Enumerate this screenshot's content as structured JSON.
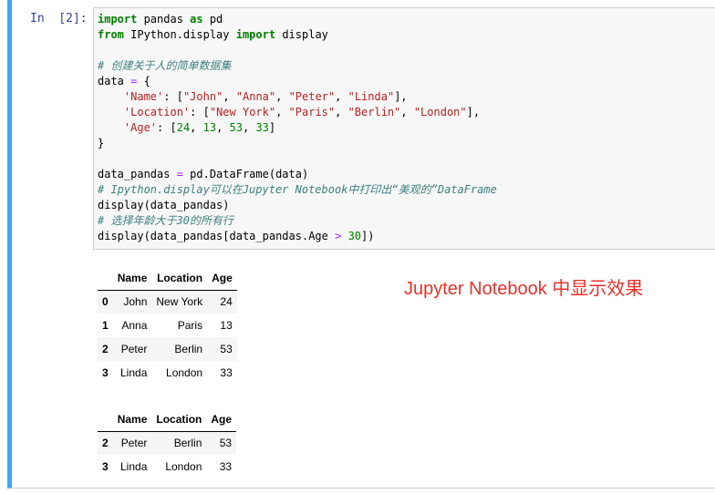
{
  "prompt": "In  [2]:",
  "code": {
    "line1": {
      "k1": "import",
      "t1": " pandas ",
      "k2": "as",
      "t2": " pd"
    },
    "line2": {
      "k1": "from",
      "t1": " IPython.display ",
      "k2": "import",
      "t2": " display"
    },
    "comment1": "# 创建关于人的简单数据集",
    "line4": {
      "t1": "data ",
      "op": "=",
      "t2": " {"
    },
    "line5": {
      "pre": "    ",
      "s1": "'Name'",
      "mid": ": [",
      "v1": "\"John\"",
      "c1": ", ",
      "v2": "\"Anna\"",
      "c2": ", ",
      "v3": "\"Peter\"",
      "c3": ", ",
      "v4": "\"Linda\"",
      "end": "],"
    },
    "line6": {
      "pre": "    ",
      "s1": "'Location'",
      "mid": ": [",
      "v1": "\"New York\"",
      "c1": ", ",
      "v2": "\"Paris\"",
      "c2": ", ",
      "v3": "\"Berlin\"",
      "c3": ", ",
      "v4": "\"London\"",
      "end": "],"
    },
    "line7": {
      "pre": "    ",
      "s1": "'Age'",
      "mid": ": [",
      "v1": "24",
      "c1": ", ",
      "v2": "13",
      "c2": ", ",
      "v3": "53",
      "c3": ", ",
      "v4": "33",
      "end": "]"
    },
    "line8": "}",
    "line10": {
      "t1": "data_pandas ",
      "op": "=",
      "t2": " pd.DataFrame(data)"
    },
    "comment2": "# Ipython.display可以在Jupyter Notebook中打印出“美观的”DataFrame",
    "line12": "display(data_pandas)",
    "comment3": "# 选择年龄大于30的所有行",
    "line14": {
      "t1": "display(data_pandas[data_pandas.Age ",
      "op": ">",
      "t2": " ",
      "n": "30",
      "t3": "])"
    }
  },
  "table1": {
    "headers": [
      "",
      "Name",
      "Location",
      "Age"
    ],
    "rows": [
      [
        "0",
        "John",
        "New York",
        "24"
      ],
      [
        "1",
        "Anna",
        "Paris",
        "13"
      ],
      [
        "2",
        "Peter",
        "Berlin",
        "53"
      ],
      [
        "3",
        "Linda",
        "London",
        "33"
      ]
    ]
  },
  "table2": {
    "headers": [
      "",
      "Name",
      "Location",
      "Age"
    ],
    "rows": [
      [
        "2",
        "Peter",
        "Berlin",
        "53"
      ],
      [
        "3",
        "Linda",
        "London",
        "33"
      ]
    ]
  },
  "annotation": "Jupyter Notebook 中显示效果",
  "colors": {
    "cell_border": "#42a5f5",
    "prompt": "#303f9f",
    "annotation": "#e8312a"
  }
}
